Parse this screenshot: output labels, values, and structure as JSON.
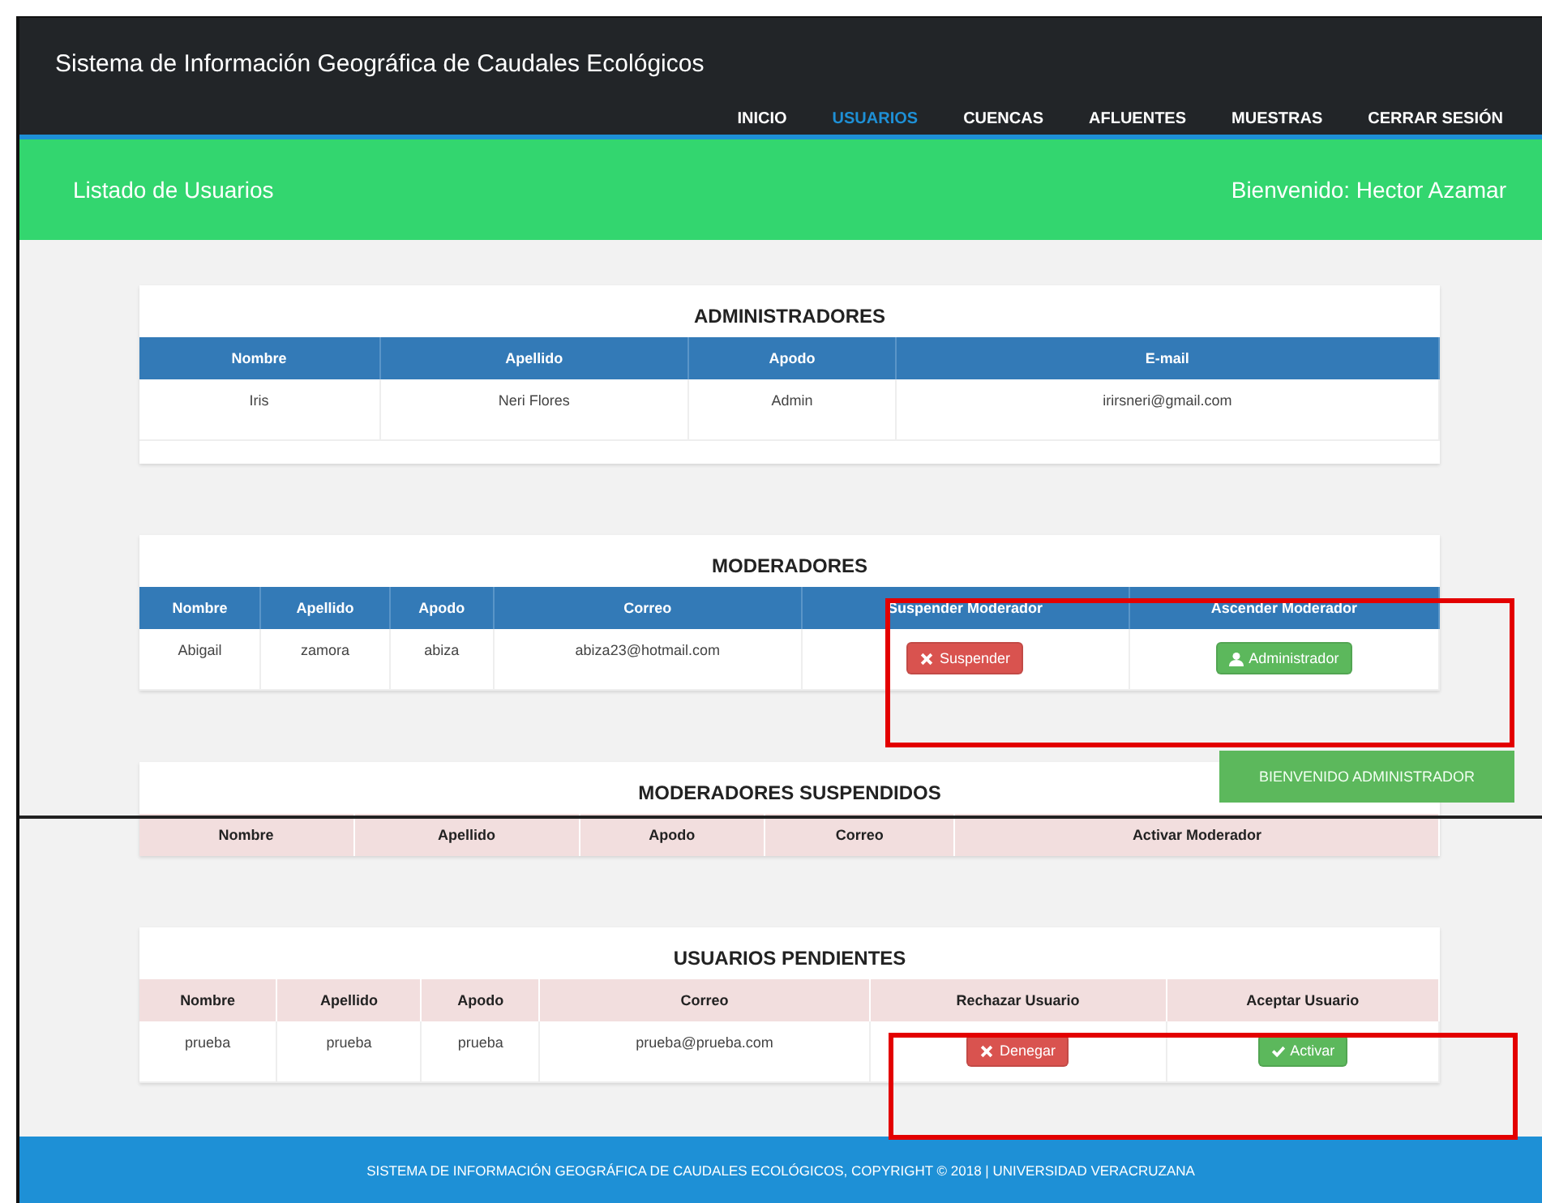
{
  "navbar": {
    "title": "Sistema de Información Geográfica de Caudales Ecológicos",
    "menu": [
      {
        "label": "INICIO",
        "selected": false
      },
      {
        "label": "USUARIOS",
        "selected": true
      },
      {
        "label": "CUENCAS",
        "selected": false
      },
      {
        "label": "AFLUENTES",
        "selected": false
      },
      {
        "label": "MUESTRAS",
        "selected": false
      },
      {
        "label": "CERRAR SESIÓN",
        "selected": false
      }
    ]
  },
  "banner": {
    "title": "Listado de Usuarios",
    "welcome": "Bienvenido: Hector Azamar"
  },
  "sections": [
    {
      "title": "ADMINISTRADORES",
      "kind": "primary",
      "columns": [
        "Nombre",
        "Apellido",
        "Apodo",
        "E-mail"
      ],
      "rows": [
        [
          "Iris",
          "Neri Flores",
          "Admin",
          "irirsneri@gmail.com"
        ]
      ]
    },
    {
      "title": "MODERADORES",
      "kind": "primary",
      "columns": [
        "Nombre",
        "Apellido",
        "Apodo",
        "Correo",
        "Suspender Moderador",
        "Ascender Moderador"
      ],
      "rows": [
        [
          "Abigail",
          "zamora",
          "abiza",
          "abiza23@hotmail.com",
          {
            "kind": "suspend",
            "label": "Suspender"
          },
          {
            "kind": "promote",
            "label": "Administrador"
          }
        ]
      ]
    },
    {
      "title": "MODERADORES SUSPENDIDOS",
      "kind": "danger",
      "columns": [
        "Nombre",
        "Apellido",
        "Apodo",
        "Correo",
        "Activar Moderador"
      ]
    },
    {
      "title": "USUARIOS PENDIENTES",
      "kind": "danger",
      "columns": [
        "Nombre",
        "Apellido",
        "Apodo",
        "Correo",
        "Rechazar Usuario",
        "Aceptar Usuario"
      ],
      "rows": [
        [
          "prueba",
          "prueba",
          "prueba",
          "prueba@prueba.com",
          {
            "kind": "deny",
            "label": "Denegar"
          },
          {
            "kind": "activate",
            "label": "Activar"
          }
        ]
      ]
    }
  ],
  "toast": "BIENVENIDO ADMINISTRADOR",
  "footer": "SISTEMA DE INFORMACIÓN GEOGRÁFICA DE CAUDALES ECOLÓGICOS, COPYRIGHT © 2018 | UNIVERSIDAD VERACRUZANA"
}
